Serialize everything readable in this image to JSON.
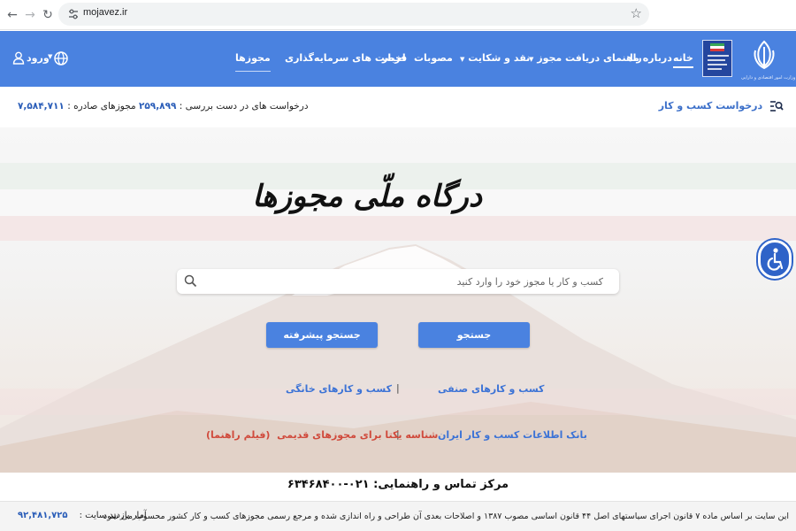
{
  "browser": {
    "url": "mojavez.ir"
  },
  "header": {
    "logo_caption": "وزارت امور اقتصادی و دارایی",
    "menu": [
      {
        "label": "خانه"
      },
      {
        "label": "درباره ما"
      },
      {
        "label": "راهنمای دریافت مجوز"
      },
      {
        "label": "نقد و شکایت"
      },
      {
        "label": "مصوبات"
      },
      {
        "label": "اخبار"
      },
      {
        "label": "فرصت های سرمایه‌گذاری"
      },
      {
        "label": "مجوزها"
      }
    ],
    "login_label": "ورود"
  },
  "stats": {
    "biz_request_label": "درخواست کسب و کار",
    "issued_label": "مجوزهای صادره :",
    "issued_value": "۲۵۹,۸۹۹",
    "pending_label": "درخواست های در دست بررسی :",
    "pending_value": "۷,۵۸۴,۷۱۱"
  },
  "hero": {
    "title": "درگاه ملّی مجوزها",
    "search_placeholder": "کسب و کار یا مجوز خود را وارد کنید",
    "search_button": "جستجو",
    "advanced_button": "جستجو پیشرفته",
    "links": {
      "guild": "کسب و کارهای صنفی",
      "home_biz": "کسب و کارهای خانگی",
      "data_bank": "بانک اطلاعات کسب و کار ایران",
      "legacy_id": "شناسه یکتا برای مجوزهای قدیمی",
      "guide_film": "(فیلم راهنما)"
    },
    "separator": "|"
  },
  "support": {
    "text": "مرکز تماس و راهنمایی: ۰۲۱-۶۳۴۶۸۴۰۰"
  },
  "footer": {
    "law_text": "این سایت بر اساس ماده ۷ قانون اجرای سیاستهای اصل ۴۴ قانون اساسی مصوب ۱۳۸۷ و اصلاحات بعدی آن طراحی و راه اندازی شده و مرجع رسمی مجوزهای کسب و کار کشور محسوب می شود",
    "visits_label": "آمار بازدید سایت :",
    "visits_value": "۹۲,۴۸۱,۷۲۵"
  },
  "colors": {
    "header_blue": "#4a82e0",
    "link_blue": "#3c73d6",
    "link_red": "#d04a3c",
    "stat_blue": "#2a5db8"
  },
  "icons": {
    "back": "arrow-left-icon",
    "forward": "arrow-right-icon",
    "reload": "reload-icon",
    "site_info": "tune-icon",
    "bookmark": "star-icon",
    "language": "globe-icon",
    "user": "user-icon",
    "list_search": "list-search-icon",
    "search": "magnifier-icon",
    "accessibility": "wheelchair-icon"
  }
}
